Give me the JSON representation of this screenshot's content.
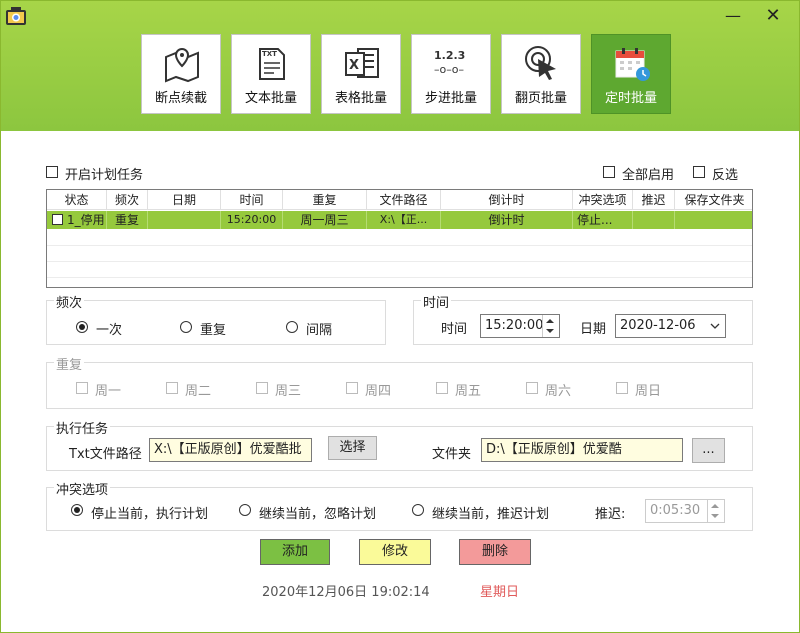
{
  "toolbar": {
    "items": [
      {
        "label": "断点续截",
        "icon": "map-pin-icon"
      },
      {
        "label": "文本批量",
        "icon": "txt-file-icon"
      },
      {
        "label": "表格批量",
        "icon": "excel-icon"
      },
      {
        "label": "步进批量",
        "icon": "step-numbers-icon"
      },
      {
        "label": "翻页批量",
        "icon": "cursor-click-icon"
      },
      {
        "label": "定时批量",
        "icon": "calendar-clock-icon",
        "active": true
      }
    ],
    "minimize": "—",
    "close": "✕"
  },
  "options": {
    "enable_plan": "开启计划任务",
    "enable_all": "全部启用",
    "invert": "反选"
  },
  "table": {
    "columns": [
      "状态",
      "频次",
      "日期",
      "时间",
      "重复",
      "文件路径",
      "倒计时",
      "冲突选项",
      "推迟",
      "保存文件夹"
    ],
    "rows": [
      [
        "1_停用",
        "重复",
        "",
        "15:20:00",
        "周一周三",
        "X:\\【正...",
        "倒计时",
        "停止...",
        "",
        ""
      ]
    ]
  },
  "frequency": {
    "title": "频次",
    "options": [
      "一次",
      "重复",
      "间隔"
    ],
    "selected": "一次"
  },
  "time_group": {
    "title": "时间",
    "time_label": "时间",
    "time_value": "15:20:00",
    "date_label": "日期",
    "date_value": "2020-12-06"
  },
  "repeat": {
    "title": "重复",
    "days": [
      "周一",
      "周二",
      "周三",
      "周四",
      "周五",
      "周六",
      "周日"
    ]
  },
  "task": {
    "title": "执行任务",
    "txt_label": "Txt文件路径",
    "txt_value": "X:\\【正版原创】优爱酷批",
    "select_button": "选择",
    "folder_label": "文件夹",
    "folder_value": "D:\\【正版原创】优爱酷",
    "browse_button": "..."
  },
  "conflict": {
    "title": "冲突选项",
    "options": [
      "停止当前，执行计划",
      "继续当前，忽略计划",
      "继续当前，推迟计划"
    ],
    "selected": "停止当前，执行计划",
    "delay_label": "推迟:",
    "delay_value": "0:05:30"
  },
  "actions": {
    "add": "添加",
    "edit": "修改",
    "delete": "删除",
    "add_color": "#7cc043",
    "edit_color": "#fafa99",
    "delete_color": "#f39a9a"
  },
  "status": {
    "datetime": "2020年12月06日 19:02:14",
    "weekday": "星期日"
  },
  "colors": {
    "header_green": "#8cc63f",
    "active_tool": "#5ea830",
    "row_highlight": "#96c93d"
  }
}
